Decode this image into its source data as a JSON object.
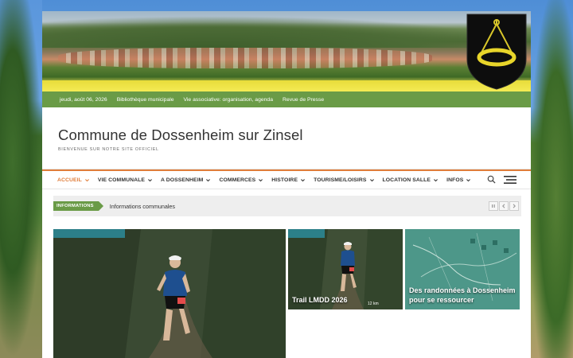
{
  "topbar": {
    "date": "jeudi, août 06, 2026",
    "links": [
      "Bibliothèque municipale",
      "Vie associative: organisation, agenda",
      "Revue de Presse"
    ]
  },
  "site": {
    "title": "Commune de Dossenheim sur Zinsel",
    "tagline": "BIENVENUE SUR NOTRE SITE OFFICIEL"
  },
  "nav": {
    "items": [
      {
        "label": "ACCUEIL",
        "active": true
      },
      {
        "label": "VIE COMMUNALE",
        "active": false
      },
      {
        "label": "A DOSSENHEIM",
        "active": false
      },
      {
        "label": "COMMERCES",
        "active": false
      },
      {
        "label": "HISTOIRE",
        "active": false
      },
      {
        "label": "TOURISME/LOISIRS",
        "active": false
      },
      {
        "label": "LOCATION SALLE",
        "active": false
      },
      {
        "label": "INFOS",
        "active": false
      }
    ],
    "search_icon": "search-icon",
    "menu_icon": "hamburger-icon"
  },
  "news": {
    "badge": "INFORMATIONS",
    "headline": "Informations communales"
  },
  "featured": {
    "large": {
      "title": ""
    },
    "small1": {
      "title": "Trail LMDD 2026"
    },
    "small2": {
      "title": "Des randonnées à Dossenheim pour se ressourcer"
    }
  },
  "colors": {
    "accent_orange": "#e07d3a",
    "topbar_green": "#6a9b47",
    "badge_green": "#6a9b47"
  }
}
